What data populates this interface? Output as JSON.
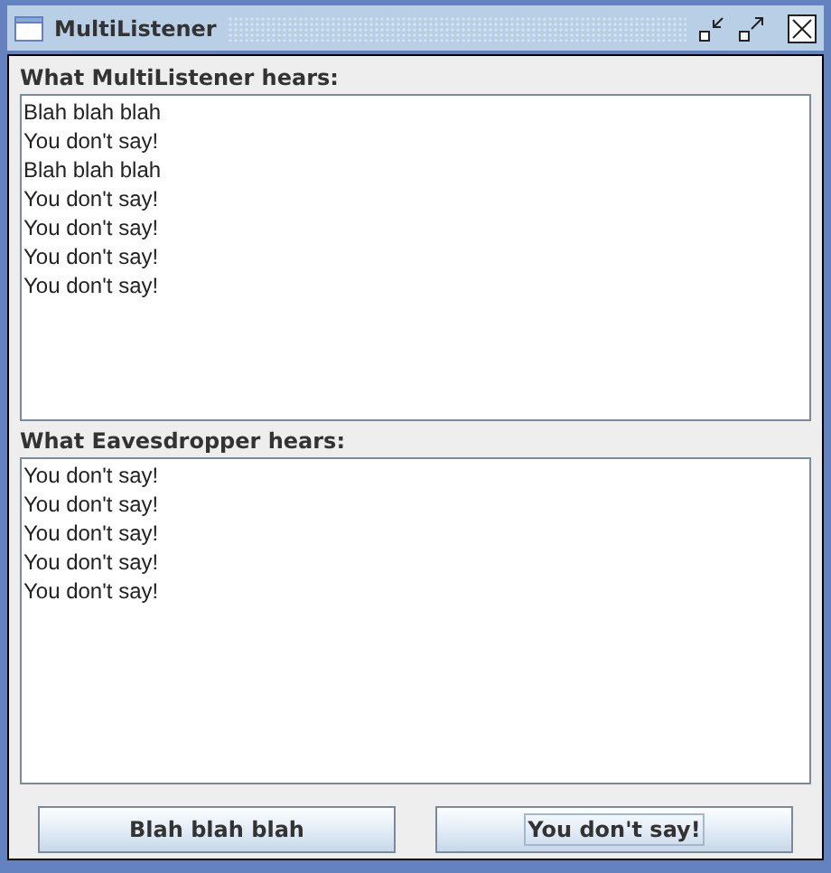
{
  "window": {
    "title": "MultiListener"
  },
  "panels": [
    {
      "label": "What MultiListener hears:",
      "lines": [
        "Blah blah blah",
        "You don't say!",
        "Blah blah blah",
        "You don't say!",
        "You don't say!",
        "You don't say!",
        "You don't say!"
      ]
    },
    {
      "label": "What Eavesdropper hears:",
      "lines": [
        "You don't say!",
        "You don't say!",
        "You don't say!",
        "You don't say!",
        "You don't say!"
      ]
    }
  ],
  "buttons": [
    {
      "label": "Blah blah blah",
      "focused": false
    },
    {
      "label": "You don't say!",
      "focused": true
    }
  ]
}
